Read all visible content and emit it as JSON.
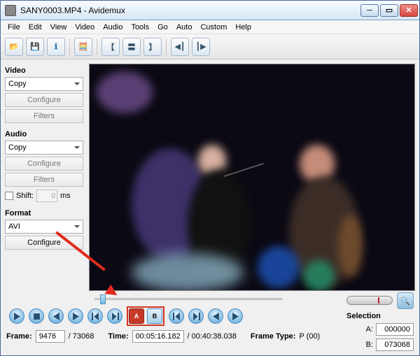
{
  "title": "SANY0003.MP4 - Avidemux",
  "menu": [
    "File",
    "Edit",
    "View",
    "Video",
    "Audio",
    "Tools",
    "Go",
    "Auto",
    "Custom",
    "Help"
  ],
  "side": {
    "video_hdr": "Video",
    "video_codec": "Copy",
    "audio_hdr": "Audio",
    "audio_codec": "Copy",
    "configure": "Configure",
    "filters": "Filters",
    "shift_label": "Shift:",
    "shift_value": "0",
    "shift_unit": "ms",
    "format_hdr": "Format",
    "format_value": "AVI"
  },
  "transport": {
    "mark_a_icon": "A",
    "mark_b_icon": "B"
  },
  "status": {
    "frame_label": "Frame:",
    "frame_cur": "9476",
    "frame_tot": "/ 73068",
    "time_label": "Time:",
    "time_cur": "00:05:16.182",
    "time_tot": "/ 00:40:38.038",
    "frametype_label": "Frame Type:",
    "frametype_value": "P (00)"
  },
  "selection": {
    "header": "Selection",
    "a_label": "A:",
    "a_value": "000000",
    "b_label": "B:",
    "b_value": "073068"
  }
}
